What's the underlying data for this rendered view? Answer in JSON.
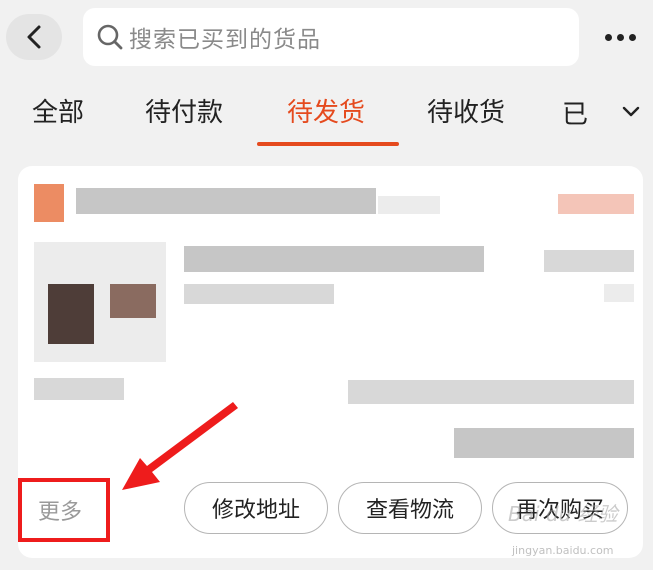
{
  "header": {
    "search_placeholder": "搜索已买到的货品"
  },
  "tabs": [
    {
      "label": "全部",
      "active": false
    },
    {
      "label": "待付款",
      "active": false
    },
    {
      "label": "待发货",
      "active": true
    },
    {
      "label": "待收货",
      "active": false
    },
    {
      "label": "已",
      "active": false,
      "partial": true
    }
  ],
  "order_actions": {
    "more_label": "更多",
    "buttons": [
      "修改地址",
      "查看物流",
      "再次购买"
    ]
  },
  "colors": {
    "accent": "#e54a1e",
    "annotation": "#ee1c1c"
  },
  "watermark": {
    "brand": "Bai du 经验",
    "url": "jingyan.baidu.com"
  }
}
